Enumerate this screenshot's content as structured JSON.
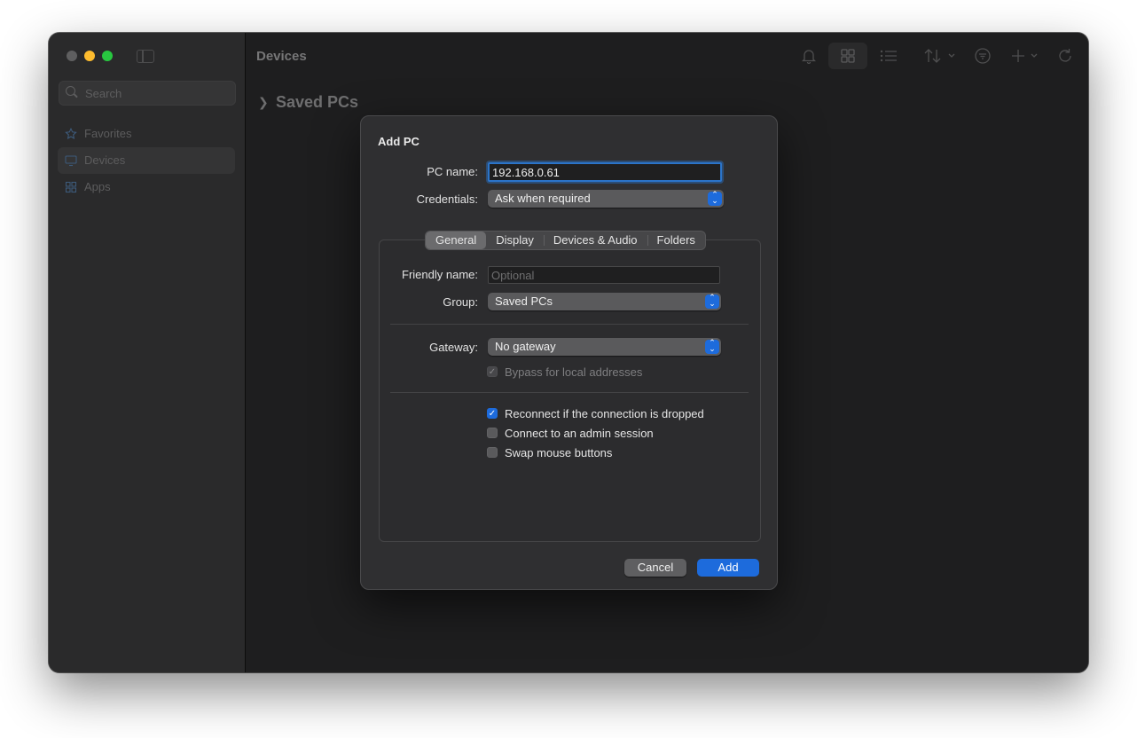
{
  "sidebar": {
    "search_placeholder": "Search",
    "items": [
      {
        "label": "Favorites",
        "icon": "star-icon",
        "selected": false
      },
      {
        "label": "Devices",
        "icon": "monitor-icon",
        "selected": true
      },
      {
        "label": "Apps",
        "icon": "apps-grid-icon",
        "selected": false
      }
    ]
  },
  "main": {
    "title": "Devices",
    "group_header": "Saved PCs",
    "toolbar_icons": [
      "bell-icon",
      "grid-view-icon",
      "list-view-icon",
      "sort-icon",
      "filter-icon",
      "add-icon",
      "refresh-icon"
    ]
  },
  "dialog": {
    "title": "Add PC",
    "pc_name_label": "PC name:",
    "pc_name_value": "192.168.0.61",
    "credentials_label": "Credentials:",
    "credentials_value": "Ask when required",
    "tabs": [
      "General",
      "Display",
      "Devices & Audio",
      "Folders"
    ],
    "active_tab": "General",
    "friendly_name_label": "Friendly name:",
    "friendly_name_placeholder": "Optional",
    "group_label": "Group:",
    "group_value": "Saved PCs",
    "gateway_label": "Gateway:",
    "gateway_value": "No gateway",
    "bypass_label": "Bypass for local addresses",
    "reconnect_label": "Reconnect if the connection is dropped",
    "admin_label": "Connect to an admin session",
    "swap_label": "Swap mouse buttons",
    "cancel_label": "Cancel",
    "add_label": "Add"
  },
  "colors": {
    "accent": "#1d6bdc",
    "window_bg": "#1e1e1f",
    "dialog_bg": "#2f2f31"
  }
}
